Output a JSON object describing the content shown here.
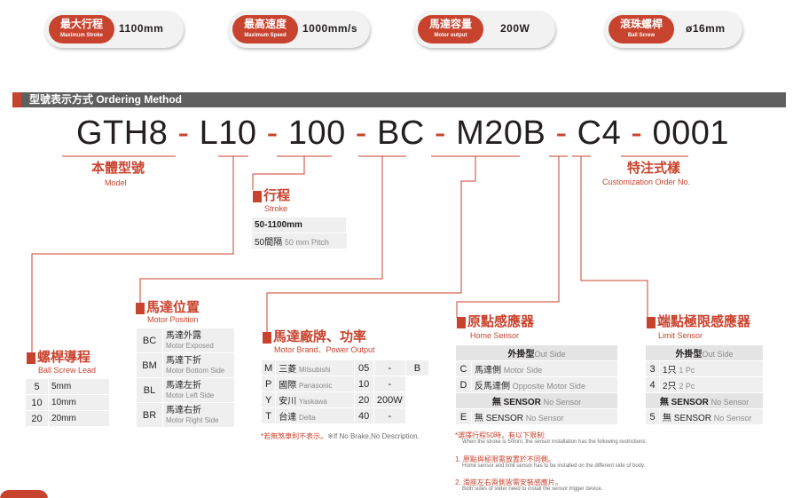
{
  "specs": [
    {
      "zh": "最大行程",
      "en": "Maximum Stroke",
      "value": "1100mm"
    },
    {
      "zh": "最高速度",
      "en": "Maximum Speed",
      "value": "1000mm/s"
    },
    {
      "zh": "馬達容量",
      "en": "Motor output",
      "value": "200W"
    },
    {
      "zh": "滾珠螺桿",
      "en": "Ball Screw",
      "value": "ø16mm"
    }
  ],
  "section_title": "型號表示方式 Ordering Method",
  "code": {
    "parts": [
      "GTH8",
      "L10",
      "100",
      "BC",
      "M20B",
      "C4",
      "0001"
    ],
    "sep": "-"
  },
  "model": {
    "zh": "本體型號",
    "en": "Model"
  },
  "custom": {
    "zh": "特注式樣",
    "en": "Customization Order No."
  },
  "stroke": {
    "zh": "行程",
    "en": "Stroke",
    "range": "50-1100mm",
    "pitch_zh": "50間隔",
    "pitch_en": "50 mm Pitch"
  },
  "lead": {
    "zh": "螺桿導程",
    "en": "Ball Screw Lead",
    "rows": [
      {
        "code": "5",
        "value": "5mm"
      },
      {
        "code": "10",
        "value": "10mm"
      },
      {
        "code": "20",
        "value": "20mm"
      }
    ]
  },
  "motor_pos": {
    "zh": "馬達位置",
    "en": "Motor Position",
    "rows": [
      {
        "code": "BC",
        "zh": "馬達外露",
        "en": "Motor Exposed"
      },
      {
        "code": "BM",
        "zh": "馬達下折",
        "en": "Motor Bottom Side"
      },
      {
        "code": "BL",
        "zh": "馬達左折",
        "en": "Motor Left Side"
      },
      {
        "code": "BR",
        "zh": "馬達右折",
        "en": "Motor Right Side"
      }
    ]
  },
  "brand": {
    "zh": "馬達廠牌、功率",
    "en": "Motor Brand、Power Output",
    "rows": [
      {
        "code": "M",
        "zh": "三菱",
        "en": "Mitsubishi",
        "num": "05",
        "power": "-",
        "b": "B"
      },
      {
        "code": "P",
        "zh": "國際",
        "en": "Panasonic",
        "num": "10",
        "power": "-",
        "b": ""
      },
      {
        "code": "Y",
        "zh": "安川",
        "en": "Yaskawa",
        "num": "20",
        "power": "200W",
        "b": ""
      },
      {
        "code": "T",
        "zh": "台達",
        "en": "Delta",
        "num": "40",
        "power": "-",
        "b": ""
      }
    ],
    "note_zh": "*若無煞車則不表示。",
    "note_en": "※If No Brake,No Description."
  },
  "home": {
    "zh": "原點感應器",
    "en": "Home Sensor",
    "header_zh": "外掛型",
    "header_en": "Out Side",
    "rows": [
      {
        "code": "C",
        "zh": "馬達側",
        "en": "Motor Side"
      },
      {
        "code": "D",
        "zh": "反馬達側",
        "en": "Opposite Motor Side"
      }
    ],
    "none_zh": "無 SENSOR",
    "none_en": "No Sensor",
    "none_code": "E",
    "none_row_zh": "無 SENSOR",
    "none_row_en": "No Sensor",
    "notes": [
      {
        "red": "*選擇行程50時，有以下限制:",
        "gray": "When the stroke is 50mm, the sensor installation has the following restrictions:"
      },
      {
        "red": "1. 原點與極限需放置於不同側。",
        "gray": "Home sensor and limit sensor has to be installed on the different side of body."
      },
      {
        "red": "2. 滑座左右兩側皆需安裝感應片。",
        "gray": "Both sides of slider need to install the sensor trigger device."
      }
    ]
  },
  "limit": {
    "zh": "端點極限感應器",
    "en": "Limit Sensor",
    "header_zh": "外掛型",
    "header_en": "Out Side",
    "rows": [
      {
        "code": "3",
        "zh": "1只",
        "en": "1 Pc"
      },
      {
        "code": "4",
        "zh": "2只",
        "en": "2 Pc"
      }
    ],
    "none_zh": "無 SENSOR",
    "none_en": "No Sensor",
    "none_code": "5",
    "none_row_zh": "無 SENSOR",
    "none_row_en": "No Sensor"
  },
  "colors": {
    "accent": "#c8432e",
    "text": "#231f20",
    "header_bar": "#5f5f5f"
  }
}
